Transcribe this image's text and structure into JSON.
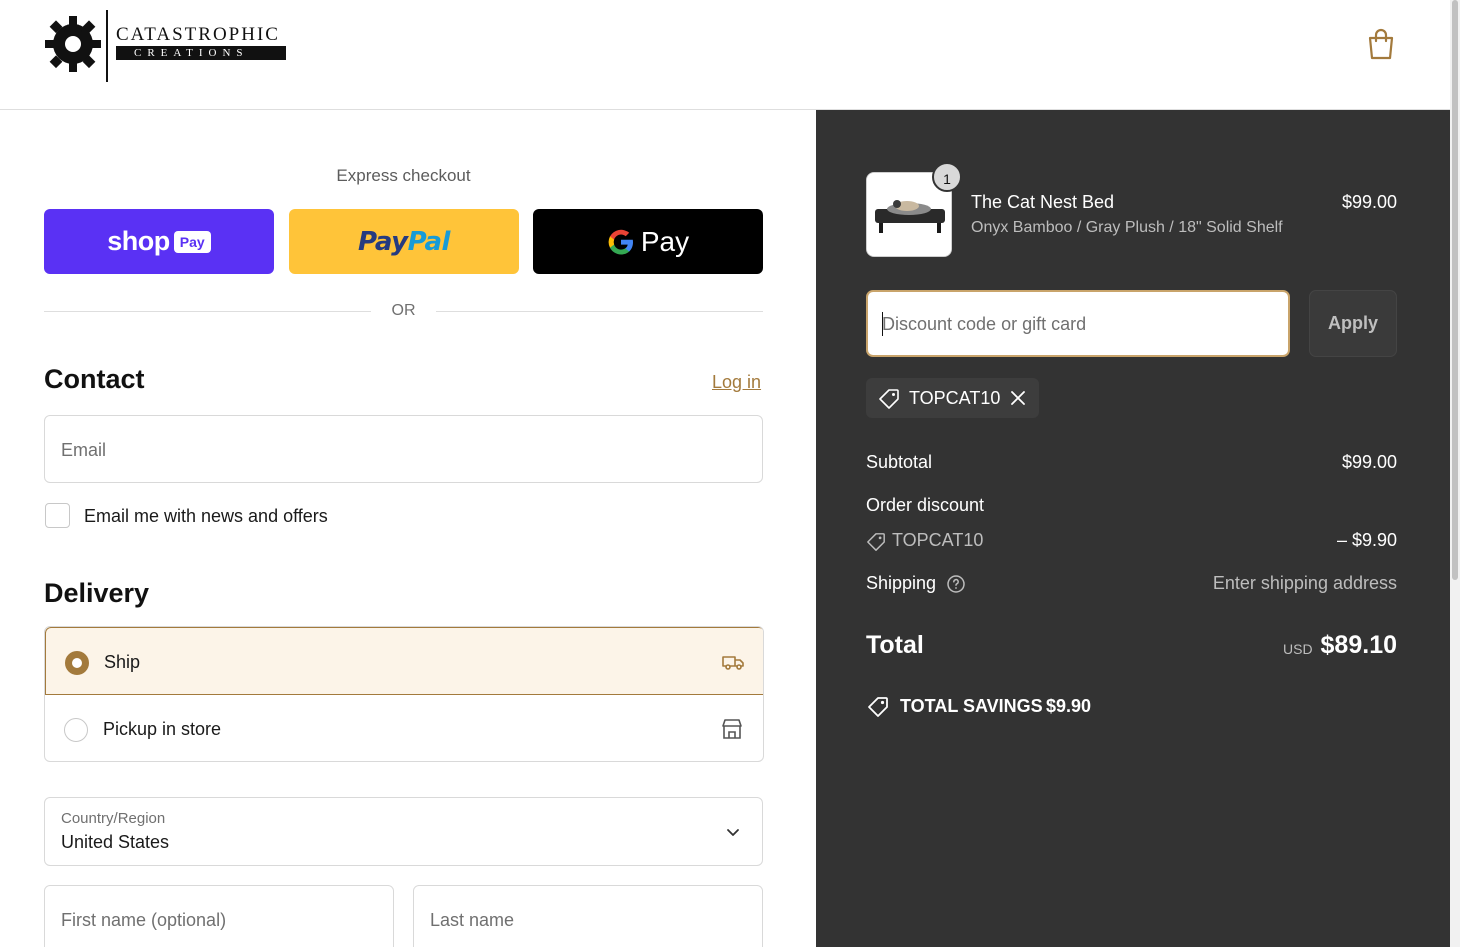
{
  "brand": {
    "name": "CATASTROPHIC",
    "tagline": "CREATIONS"
  },
  "express": {
    "title": "Express checkout",
    "shop_pay": {
      "word": "shop",
      "badge": "Pay"
    },
    "paypal": {
      "part1": "Pay",
      "part2": "Pal"
    },
    "gpay": {
      "g": "G",
      "word": "Pay"
    },
    "or_label": "OR"
  },
  "contact": {
    "title": "Contact",
    "login_label": "Log in",
    "email_placeholder": "Email",
    "newsletter_label": "Email me with news and offers"
  },
  "delivery": {
    "title": "Delivery",
    "options": [
      {
        "label": "Ship",
        "selected": true,
        "icon": "truck-icon"
      },
      {
        "label": "Pickup in store",
        "selected": false,
        "icon": "store-icon"
      }
    ],
    "country_label": "Country/Region",
    "country_value": "United States",
    "first_name_placeholder": "First name (optional)",
    "last_name_placeholder": "Last name"
  },
  "order": {
    "product": {
      "quantity": "1",
      "name": "The Cat Nest Bed",
      "variant": "Onyx Bamboo / Gray Plush / 18\" Solid Shelf",
      "price": "$99.00"
    },
    "discount_placeholder": "Discount code or gift card",
    "apply_label": "Apply",
    "applied_code": "TOPCAT10",
    "subtotal_label": "Subtotal",
    "subtotal_value": "$99.00",
    "order_discount_label": "Order discount",
    "discount_code": "TOPCAT10",
    "discount_value": "– $9.90",
    "shipping_label": "Shipping",
    "shipping_value": "Enter shipping address",
    "total_label": "Total",
    "total_currency": "USD",
    "total_value": "$89.10",
    "savings_label": "TOTAL SAVINGS",
    "savings_value": "$9.90"
  },
  "colors": {
    "accent": "#a37a3c",
    "shop_pay": "#5a31f4",
    "paypal": "#ffc439",
    "summary_bg": "#333333"
  }
}
